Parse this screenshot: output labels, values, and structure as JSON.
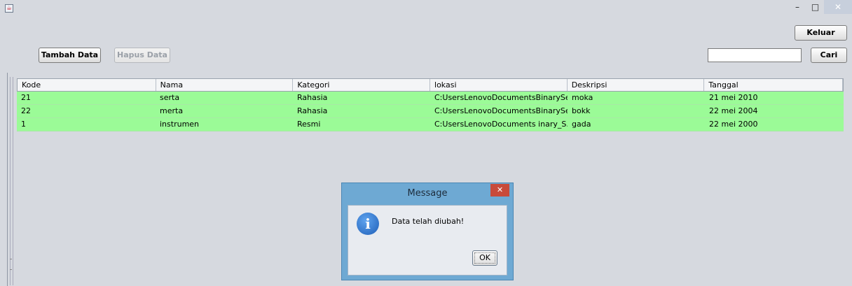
{
  "window": {
    "icon_glyph": "☕",
    "minimize_glyph": "–",
    "maximize_glyph": "□",
    "close_glyph": "✕"
  },
  "toolbar": {
    "add_label": "Tambah Data",
    "delete_label": "Hapus Data",
    "exit_label": "Keluar",
    "search_label": "Cari",
    "search_value": ""
  },
  "table": {
    "columns": [
      "Kode",
      "Nama",
      "Kategori",
      "lokasi",
      "Deskripsi",
      "Tanggal"
    ],
    "rows": [
      [
        "21",
        "serta",
        "Rahasia",
        "C:UsersLenovoDocumentsBinarySe...",
        "moka",
        "21 mei 2010"
      ],
      [
        "22",
        "merta",
        "Rahasia",
        "C:UsersLenovoDocumentsBinarySe...",
        "bokk",
        "22 mei 2004"
      ],
      [
        "1",
        "instrumen",
        "Resmi",
        "C:UsersLenovoDocuments  inary_S.txt",
        "gada",
        "22 mei 2000"
      ]
    ]
  },
  "dialog": {
    "title": "Message",
    "close_glyph": "✕",
    "icon_glyph": "i",
    "message": "Data telah diubah!",
    "ok_label": "OK"
  },
  "colors": {
    "row_highlight": "#9bfb97",
    "dialog_frame": "#6ea9d3",
    "dialog_close": "#c84a3a"
  }
}
